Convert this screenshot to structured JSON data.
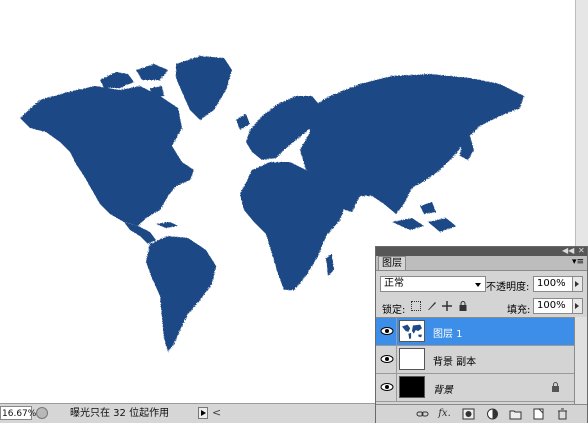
{
  "canvas": {
    "map_color": "#1f4a86",
    "background": "#ffffff"
  },
  "statusbar": {
    "zoom": "16.67%",
    "message": "曝光只在 32 位起作用",
    "scroll_left_glyph": "<"
  },
  "layers_panel": {
    "collapse_glyph": "◀◀",
    "close_glyph": "✕",
    "tab_label": "图层",
    "menu_glyph": "▾≡",
    "blend_mode": "正常",
    "opacity_label": "不透明度:",
    "opacity_value": "100%",
    "lock_label": "锁定:",
    "fill_label": "填充:",
    "fill_value": "100%",
    "layers": [
      {
        "name": "图层 1",
        "selected": true,
        "visible": true,
        "thumb": "world-map"
      },
      {
        "name": "背景 副本",
        "selected": false,
        "visible": true,
        "thumb": "white"
      },
      {
        "name": "背景",
        "selected": false,
        "visible": true,
        "thumb": "black",
        "locked": true
      }
    ],
    "footer_icons": [
      "link-icon",
      "fx-icon",
      "mask-icon",
      "adjustment-icon",
      "group-folder-icon",
      "new-layer-icon",
      "trash-icon"
    ],
    "fx_label": "fx."
  }
}
